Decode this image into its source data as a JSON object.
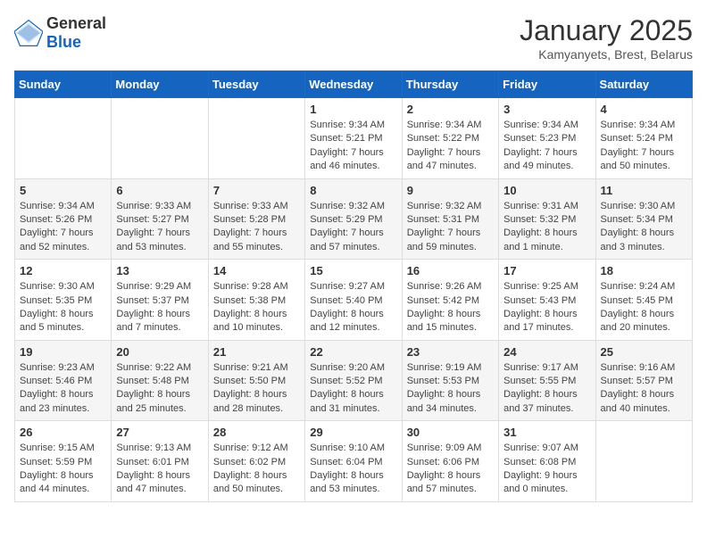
{
  "header": {
    "logo_general": "General",
    "logo_blue": "Blue",
    "title": "January 2025",
    "subtitle": "Kamyanyets, Brest, Belarus"
  },
  "weekdays": [
    "Sunday",
    "Monday",
    "Tuesday",
    "Wednesday",
    "Thursday",
    "Friday",
    "Saturday"
  ],
  "weeks": [
    [
      {
        "day": "",
        "info": ""
      },
      {
        "day": "",
        "info": ""
      },
      {
        "day": "",
        "info": ""
      },
      {
        "day": "1",
        "info": "Sunrise: 9:34 AM\nSunset: 5:21 PM\nDaylight: 7 hours and 46 minutes."
      },
      {
        "day": "2",
        "info": "Sunrise: 9:34 AM\nSunset: 5:22 PM\nDaylight: 7 hours and 47 minutes."
      },
      {
        "day": "3",
        "info": "Sunrise: 9:34 AM\nSunset: 5:23 PM\nDaylight: 7 hours and 49 minutes."
      },
      {
        "day": "4",
        "info": "Sunrise: 9:34 AM\nSunset: 5:24 PM\nDaylight: 7 hours and 50 minutes."
      }
    ],
    [
      {
        "day": "5",
        "info": "Sunrise: 9:34 AM\nSunset: 5:26 PM\nDaylight: 7 hours and 52 minutes."
      },
      {
        "day": "6",
        "info": "Sunrise: 9:33 AM\nSunset: 5:27 PM\nDaylight: 7 hours and 53 minutes."
      },
      {
        "day": "7",
        "info": "Sunrise: 9:33 AM\nSunset: 5:28 PM\nDaylight: 7 hours and 55 minutes."
      },
      {
        "day": "8",
        "info": "Sunrise: 9:32 AM\nSunset: 5:29 PM\nDaylight: 7 hours and 57 minutes."
      },
      {
        "day": "9",
        "info": "Sunrise: 9:32 AM\nSunset: 5:31 PM\nDaylight: 7 hours and 59 minutes."
      },
      {
        "day": "10",
        "info": "Sunrise: 9:31 AM\nSunset: 5:32 PM\nDaylight: 8 hours and 1 minute."
      },
      {
        "day": "11",
        "info": "Sunrise: 9:30 AM\nSunset: 5:34 PM\nDaylight: 8 hours and 3 minutes."
      }
    ],
    [
      {
        "day": "12",
        "info": "Sunrise: 9:30 AM\nSunset: 5:35 PM\nDaylight: 8 hours and 5 minutes."
      },
      {
        "day": "13",
        "info": "Sunrise: 9:29 AM\nSunset: 5:37 PM\nDaylight: 8 hours and 7 minutes."
      },
      {
        "day": "14",
        "info": "Sunrise: 9:28 AM\nSunset: 5:38 PM\nDaylight: 8 hours and 10 minutes."
      },
      {
        "day": "15",
        "info": "Sunrise: 9:27 AM\nSunset: 5:40 PM\nDaylight: 8 hours and 12 minutes."
      },
      {
        "day": "16",
        "info": "Sunrise: 9:26 AM\nSunset: 5:42 PM\nDaylight: 8 hours and 15 minutes."
      },
      {
        "day": "17",
        "info": "Sunrise: 9:25 AM\nSunset: 5:43 PM\nDaylight: 8 hours and 17 minutes."
      },
      {
        "day": "18",
        "info": "Sunrise: 9:24 AM\nSunset: 5:45 PM\nDaylight: 8 hours and 20 minutes."
      }
    ],
    [
      {
        "day": "19",
        "info": "Sunrise: 9:23 AM\nSunset: 5:46 PM\nDaylight: 8 hours and 23 minutes."
      },
      {
        "day": "20",
        "info": "Sunrise: 9:22 AM\nSunset: 5:48 PM\nDaylight: 8 hours and 25 minutes."
      },
      {
        "day": "21",
        "info": "Sunrise: 9:21 AM\nSunset: 5:50 PM\nDaylight: 8 hours and 28 minutes."
      },
      {
        "day": "22",
        "info": "Sunrise: 9:20 AM\nSunset: 5:52 PM\nDaylight: 8 hours and 31 minutes."
      },
      {
        "day": "23",
        "info": "Sunrise: 9:19 AM\nSunset: 5:53 PM\nDaylight: 8 hours and 34 minutes."
      },
      {
        "day": "24",
        "info": "Sunrise: 9:17 AM\nSunset: 5:55 PM\nDaylight: 8 hours and 37 minutes."
      },
      {
        "day": "25",
        "info": "Sunrise: 9:16 AM\nSunset: 5:57 PM\nDaylight: 8 hours and 40 minutes."
      }
    ],
    [
      {
        "day": "26",
        "info": "Sunrise: 9:15 AM\nSunset: 5:59 PM\nDaylight: 8 hours and 44 minutes."
      },
      {
        "day": "27",
        "info": "Sunrise: 9:13 AM\nSunset: 6:01 PM\nDaylight: 8 hours and 47 minutes."
      },
      {
        "day": "28",
        "info": "Sunrise: 9:12 AM\nSunset: 6:02 PM\nDaylight: 8 hours and 50 minutes."
      },
      {
        "day": "29",
        "info": "Sunrise: 9:10 AM\nSunset: 6:04 PM\nDaylight: 8 hours and 53 minutes."
      },
      {
        "day": "30",
        "info": "Sunrise: 9:09 AM\nSunset: 6:06 PM\nDaylight: 8 hours and 57 minutes."
      },
      {
        "day": "31",
        "info": "Sunrise: 9:07 AM\nSunset: 6:08 PM\nDaylight: 9 hours and 0 minutes."
      },
      {
        "day": "",
        "info": ""
      }
    ]
  ]
}
